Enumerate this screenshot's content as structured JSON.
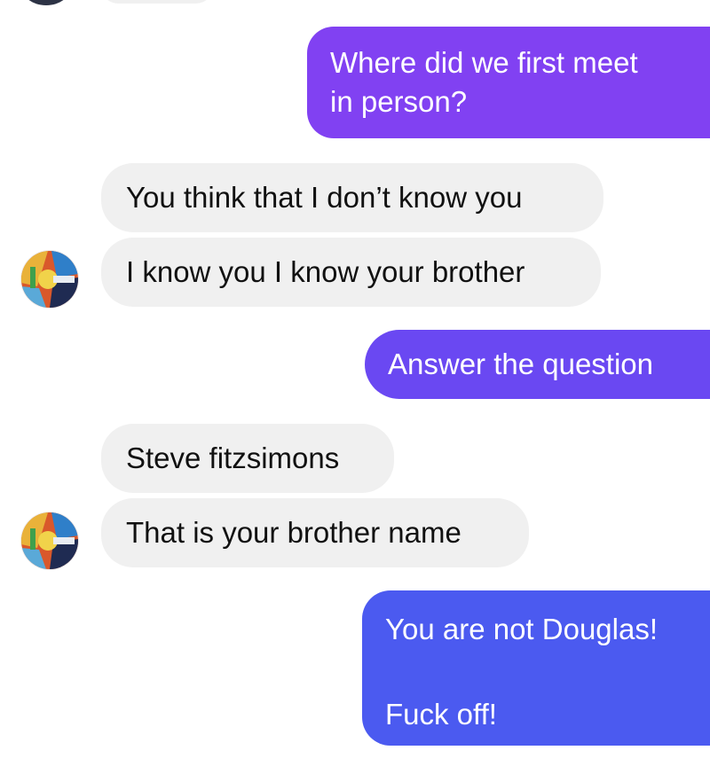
{
  "conversation": {
    "messages": [
      {
        "direction": "outgoing",
        "text": "Where did we first meet\nin person?",
        "color": "#7c3cf0"
      },
      {
        "direction": "incoming",
        "text": "You think that I don’t know you",
        "color": "#f0f0f0"
      },
      {
        "direction": "incoming",
        "text": "I know you I know your brother",
        "color": "#f0f0f0"
      },
      {
        "direction": "outgoing",
        "text": "Answer the question",
        "color": "#6a45f2"
      },
      {
        "direction": "incoming",
        "text": "Steve fitzsimons",
        "color": "#f0f0f0"
      },
      {
        "direction": "incoming",
        "text": "That is your brother name",
        "color": "#f0f0f0"
      },
      {
        "direction": "outgoing",
        "text": "You are not Douglas!\n\nFuck off!",
        "color": "#4a5af0"
      }
    ],
    "contact_avatar_icon": "profile-avatar-icon"
  },
  "theme": {
    "incoming_bubble": "#f0f0f0",
    "outgoing_gradient_top": "#8440f2",
    "outgoing_gradient_bottom": "#4a5cf0",
    "background": "#ffffff"
  }
}
